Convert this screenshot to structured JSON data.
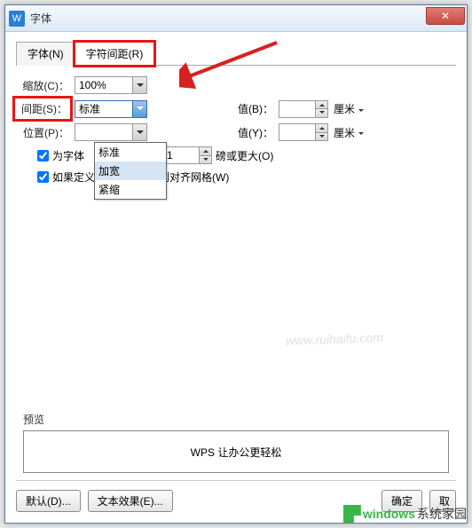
{
  "window": {
    "title": "字体",
    "icon_letter": "W"
  },
  "tabs": {
    "font": "字体(N)",
    "spacing": "字符间距(R)"
  },
  "rows": {
    "scale": {
      "label": "缩放(C)：",
      "value": "100%"
    },
    "spacing": {
      "label": "间距(S)：",
      "value": "标准",
      "value_b_label": "值(B)：",
      "value_b": "",
      "unit_b": "厘米"
    },
    "position": {
      "label": "位置(P)：",
      "value": "",
      "value_y_label": "值(Y)：",
      "value_y": "",
      "unit_y": "厘米"
    },
    "kerning": {
      "label": "为字体",
      "value": "1",
      "unit": "磅或更大(O)"
    }
  },
  "dropdown": {
    "options": [
      "标准",
      "加宽",
      "紧缩"
    ]
  },
  "checkboxes": {
    "kerning_text_partial": "为字体",
    "snap_grid": "如果定义了文档网格，则对齐网格(W)"
  },
  "preview": {
    "label": "预览",
    "text": "WPS 让办公更轻松"
  },
  "buttons": {
    "default": "默认(D)...",
    "text_effect": "文本效果(E)...",
    "ok": "确定",
    "cancel": "取"
  },
  "watermark": {
    "site": "www.ruihaifu.com",
    "brand1": "windows",
    "brand2": "系统家园"
  }
}
